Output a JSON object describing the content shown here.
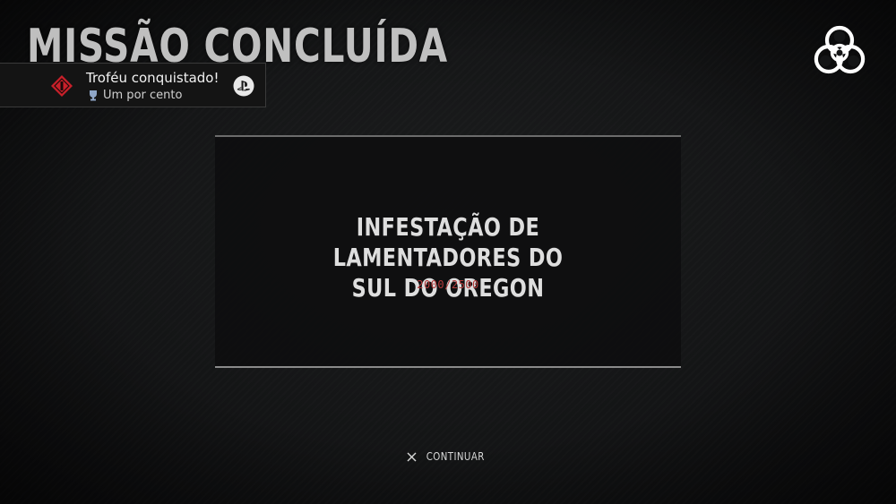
{
  "screen": {
    "title": "MISSÃO CONCLUÍDA"
  },
  "trophy_notification": {
    "title": "Troféu conquistado!",
    "trophy_name": "Um por cento",
    "badge_icon": "red-diamond-trophy-icon",
    "trophy_icon": "silver-trophy-cup-icon",
    "platform_icon": "playstation-logo-icon"
  },
  "mission": {
    "name": "INFESTAÇÃO DE LAMENTADORES DO\nSUL DO OREGON",
    "progress": "2000/2500"
  },
  "prompt": {
    "button_icon": "cross-button-icon",
    "label": "CONTINUAR"
  },
  "colors": {
    "background": "#141516",
    "progress_red": "#b23a3a",
    "badge_red": "#c8202a",
    "text": "#dedede"
  }
}
